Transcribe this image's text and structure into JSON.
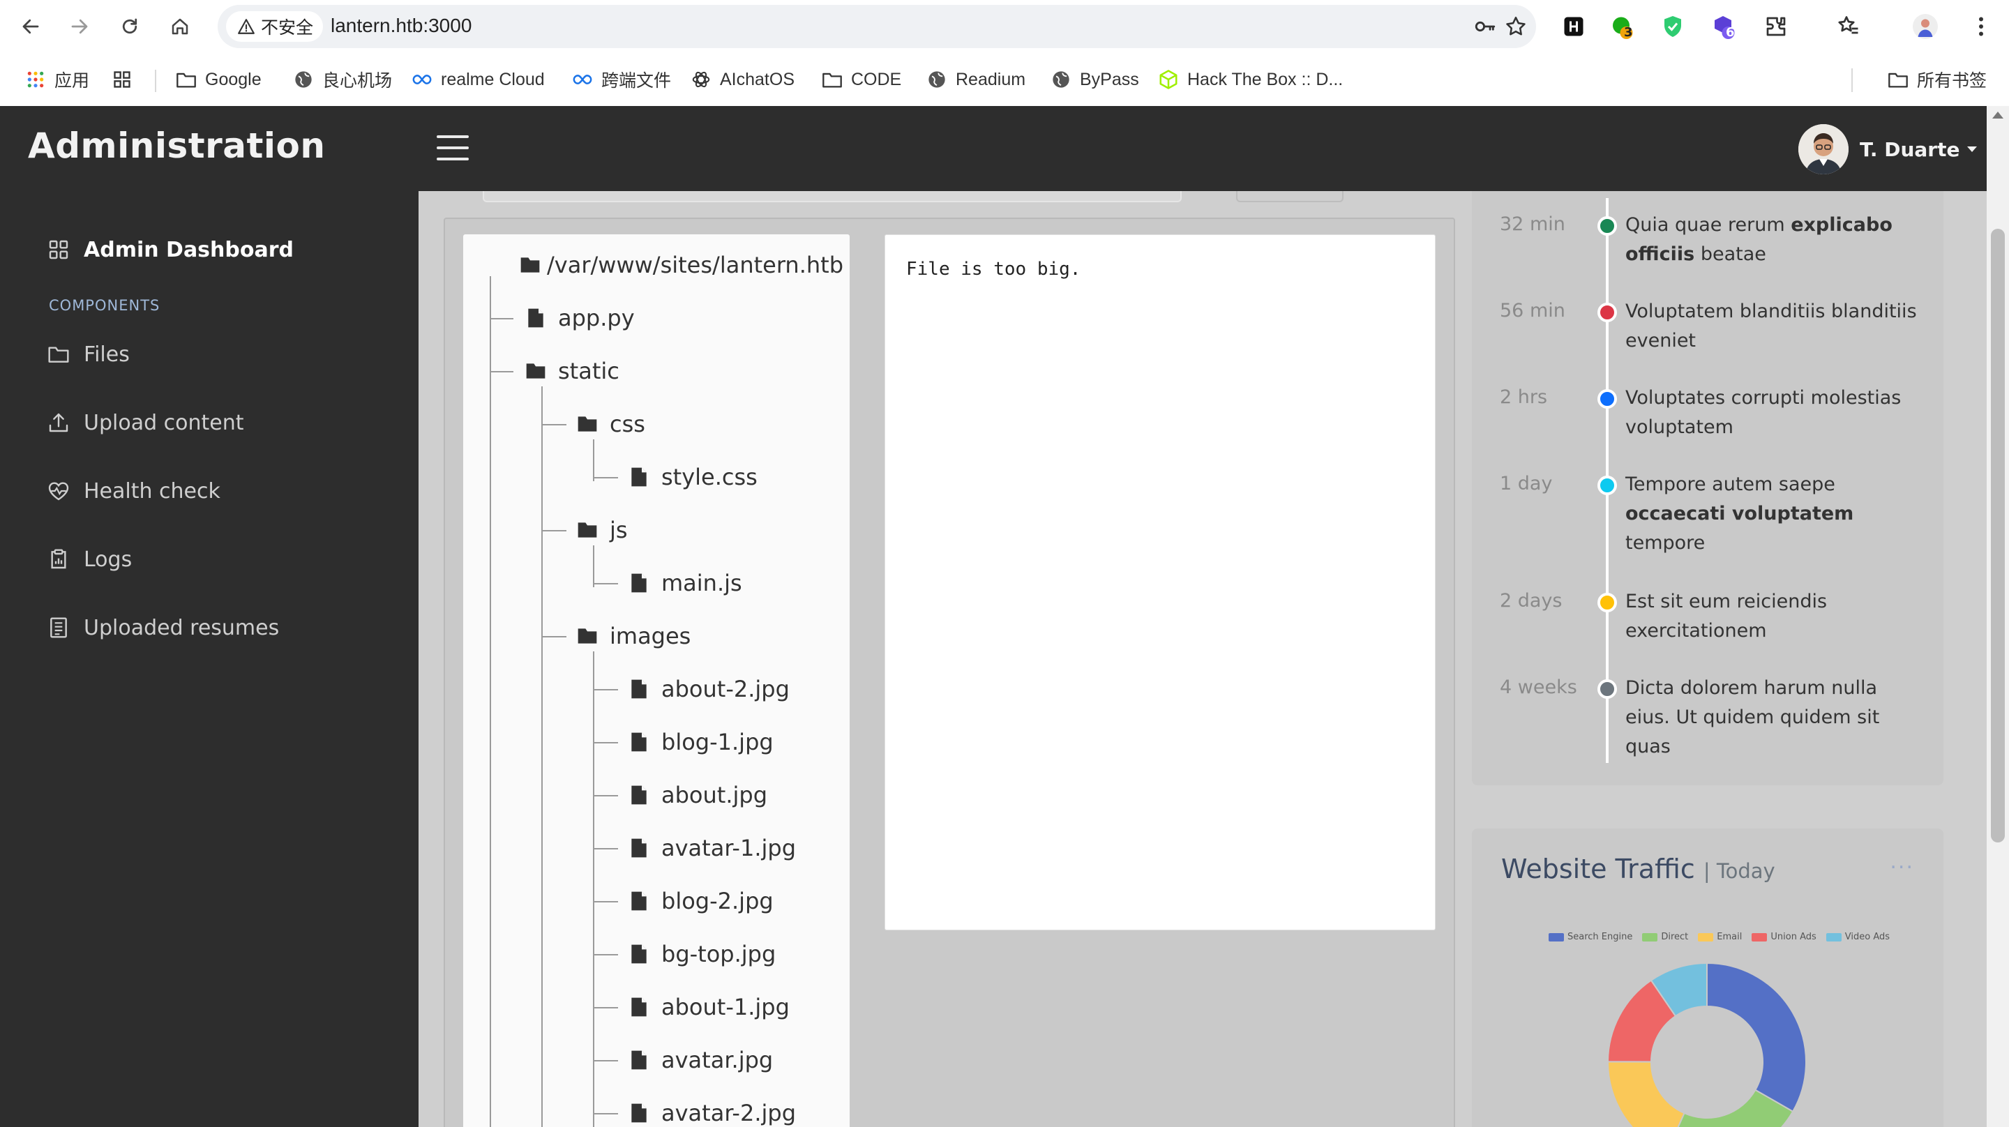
{
  "browser": {
    "security_label": "不安全",
    "url": "lantern.htb:3000",
    "extension_badges": {
      "ext1": "3",
      "ext2": "6"
    },
    "bookmarks": [
      {
        "label": "应用",
        "icon": "apps-grid-icon"
      },
      {
        "label": "",
        "icon": "tab-groups-icon"
      },
      {
        "label": "Google",
        "icon": "folder-icon"
      },
      {
        "label": "良心机场",
        "icon": "globe-icon"
      },
      {
        "label": "realme Cloud",
        "icon": "infinity-icon"
      },
      {
        "label": "跨端文件",
        "icon": "infinity-icon"
      },
      {
        "label": "AIchatOS",
        "icon": "openai-icon"
      },
      {
        "label": "CODE",
        "icon": "folder-icon"
      },
      {
        "label": "Readium",
        "icon": "globe-icon"
      },
      {
        "label": "ByPass",
        "icon": "globe-icon"
      },
      {
        "label": "Hack The Box :: D...",
        "icon": "htb-cube-icon"
      }
    ],
    "other_bookmarks": "所有书签"
  },
  "app": {
    "title": "Administration",
    "user_name": "T. Duarte"
  },
  "sidebar": {
    "dashboard": "Admin Dashboard",
    "section_label": "COMPONENTS",
    "items": [
      {
        "label": "Files",
        "icon": "folder-icon"
      },
      {
        "label": "Upload content",
        "icon": "upload-icon"
      },
      {
        "label": "Health check",
        "icon": "heart-pulse-icon"
      },
      {
        "label": "Logs",
        "icon": "clipboard-data-icon"
      },
      {
        "label": "Uploaded resumes",
        "icon": "journal-text-icon"
      }
    ]
  },
  "file_tree": {
    "root": "/var/www/sites/lantern.htb",
    "nodes": [
      {
        "label": "app.py",
        "type": "file"
      },
      {
        "label": "static",
        "type": "folder"
      },
      {
        "label": "css",
        "type": "folder"
      },
      {
        "label": "style.css",
        "type": "file"
      },
      {
        "label": "js",
        "type": "folder"
      },
      {
        "label": "main.js",
        "type": "file"
      },
      {
        "label": "images",
        "type": "folder"
      },
      {
        "label": "about-2.jpg",
        "type": "file"
      },
      {
        "label": "blog-1.jpg",
        "type": "file"
      },
      {
        "label": "about.jpg",
        "type": "file"
      },
      {
        "label": "avatar-1.jpg",
        "type": "file"
      },
      {
        "label": "blog-2.jpg",
        "type": "file"
      },
      {
        "label": "bg-top.jpg",
        "type": "file"
      },
      {
        "label": "about-1.jpg",
        "type": "file"
      },
      {
        "label": "avatar.jpg",
        "type": "file"
      },
      {
        "label": "avatar-2.jpg",
        "type": "file"
      }
    ]
  },
  "viewer": {
    "message": "File is too big."
  },
  "activity": [
    {
      "time": "32 min",
      "color": "#198754",
      "html": "Quia quae rerum <b>explicabo officiis</b> beatae"
    },
    {
      "time": "56 min",
      "color": "#dc3545",
      "html": "Voluptatem blanditiis blanditiis eveniet"
    },
    {
      "time": "2 hrs",
      "color": "#0d6efd",
      "html": "Voluptates corrupti molestias voluptatem"
    },
    {
      "time": "1 day",
      "color": "#0dcaf0",
      "html": "Tempore autem saepe <b>occaecati voluptatem</b> tempore"
    },
    {
      "time": "2 days",
      "color": "#ffc107",
      "html": "Est sit eum reiciendis exercitationem"
    },
    {
      "time": "4 weeks",
      "color": "#6c757d",
      "html": "Dicta dolorem harum nulla eius. Ut quidem quidem sit quas"
    }
  ],
  "traffic": {
    "title": "Website Traffic",
    "subtitle": "| Today",
    "more": "..."
  },
  "chart_data": {
    "type": "pie",
    "categories": [
      "Search Engine",
      "Direct",
      "Email",
      "Union Ads",
      "Video Ads"
    ],
    "values": [
      1048,
      735,
      580,
      484,
      300
    ],
    "colors": [
      "#5470c6",
      "#91cc75",
      "#fac858",
      "#ee6666",
      "#73c0de"
    ]
  }
}
